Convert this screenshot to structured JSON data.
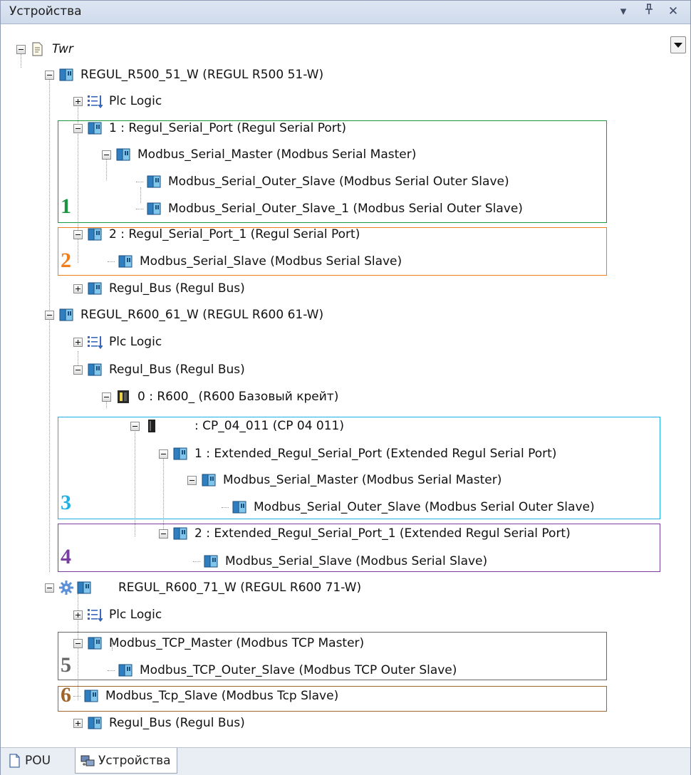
{
  "panel": {
    "title": "Устройства"
  },
  "titlebar_buttons": [
    "▾",
    "▕",
    "✕"
  ],
  "tree": [
    {
      "label": "Twr",
      "icon": "project-icon",
      "italic": true
    },
    {
      "label": "REGUL_R500_51_W (REGUL R500 51-W)",
      "icon": "device-icon"
    },
    {
      "label": "Plc Logic",
      "icon": "plc-logic-icon"
    },
    {
      "label": "1 : Regul_Serial_Port (Regul Serial Port)",
      "icon": "device-icon"
    },
    {
      "label": "Modbus_Serial_Master (Modbus Serial Master)",
      "icon": "device-icon"
    },
    {
      "label": "Modbus_Serial_Outer_Slave (Modbus Serial Outer Slave)",
      "icon": "device-icon"
    },
    {
      "label": "Modbus_Serial_Outer_Slave_1 (Modbus Serial Outer Slave)",
      "icon": "device-icon"
    },
    {
      "label": "2 : Regul_Serial_Port_1 (Regul Serial Port)",
      "icon": "device-icon"
    },
    {
      "label": "Modbus_Serial_Slave (Modbus Serial Slave)",
      "icon": "device-icon"
    },
    {
      "label": "Regul_Bus (Regul Bus)",
      "icon": "device-icon"
    },
    {
      "label": "REGUL_R600_61_W (REGUL R600 61-W)",
      "icon": "device-icon"
    },
    {
      "label": "Plc Logic",
      "icon": "plc-logic-icon"
    },
    {
      "label": "Regul_Bus (Regul Bus)",
      "icon": "device-icon"
    },
    {
      "label": "0 : R600_ (R600 Базовый крейт)",
      "icon": "crate-icon"
    },
    {
      "label": ": CP_04_011 (CP 04 011)",
      "icon": "module-icon"
    },
    {
      "label": "1 : Extended_Regul_Serial_Port (Extended Regul Serial Port)",
      "icon": "device-icon"
    },
    {
      "label": "Modbus_Serial_Master (Modbus Serial Master)",
      "icon": "device-icon"
    },
    {
      "label": "Modbus_Serial_Outer_Slave (Modbus Serial Outer Slave)",
      "icon": "device-icon"
    },
    {
      "label": "2 : Extended_Regul_Serial_Port_1 (Extended Regul Serial Port)",
      "icon": "device-icon"
    },
    {
      "label": "Modbus_Serial_Slave (Modbus Serial Slave)",
      "icon": "device-icon"
    },
    {
      "label": "REGUL_R600_71_W (REGUL R600 71-W)",
      "icon": "device-gear-icon"
    },
    {
      "label": "Plc Logic",
      "icon": "plc-logic-icon"
    },
    {
      "label": "Modbus_TCP_Master (Modbus TCP Master)",
      "icon": "device-icon"
    },
    {
      "label": "Modbus_TCP_Outer_Slave (Modbus TCP Outer Slave)",
      "icon": "device-icon"
    },
    {
      "label": "Modbus_Tcp_Slave (Modbus Tcp Slave)",
      "icon": "device-icon"
    },
    {
      "label": "Regul_Bus (Regul Bus)",
      "icon": "device-icon"
    }
  ],
  "annotations": [
    {
      "number": "1",
      "color": "#1a9641"
    },
    {
      "number": "2",
      "color": "#f07d1a"
    },
    {
      "number": "3",
      "color": "#1fb0e6"
    },
    {
      "number": "4",
      "color": "#7a3ea0"
    },
    {
      "number": "5",
      "color": "#666666"
    },
    {
      "number": "6",
      "color": "#a0652a"
    }
  ],
  "tabs": [
    {
      "label": "POU",
      "icon": "pou-icon",
      "active": false
    },
    {
      "label": "Устройства",
      "icon": "devices-icon",
      "active": true
    }
  ]
}
